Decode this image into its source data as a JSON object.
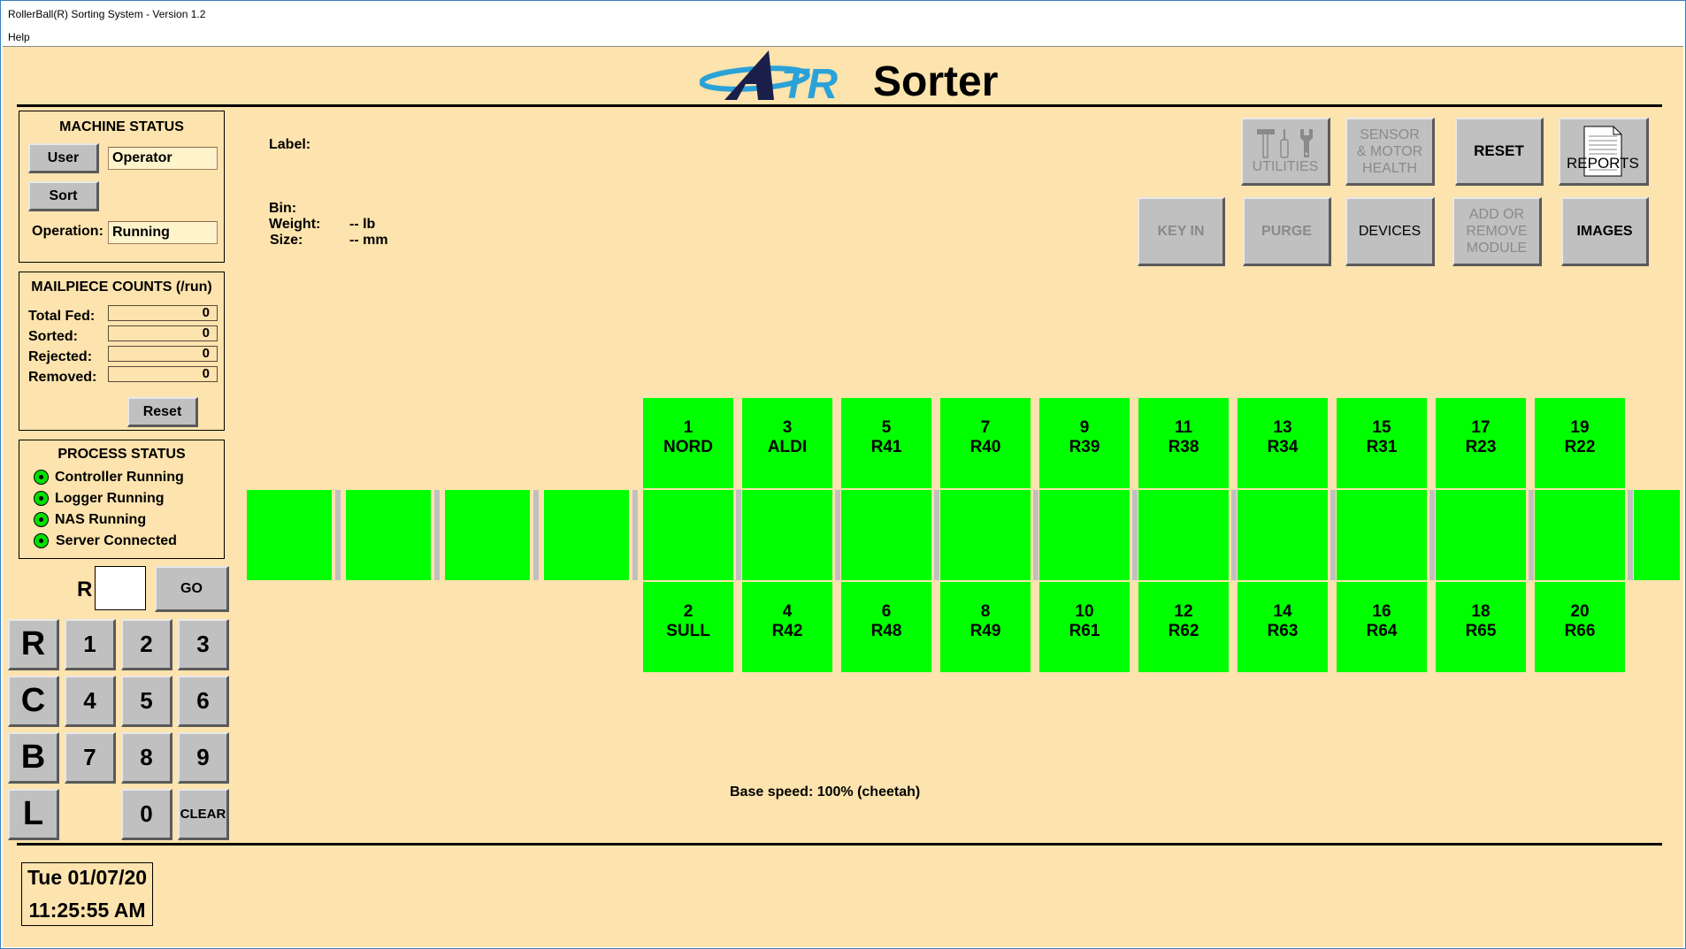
{
  "window": {
    "title": "RollerBall(R) Sorting System - Version 1.2",
    "menu": [
      "Help"
    ]
  },
  "header": {
    "logo_text": "TR",
    "title": "Sorter",
    "logo_colors": {
      "navy": "#1a1f4a",
      "blue": "#2aa2d8"
    }
  },
  "machine_status": {
    "title": "MACHINE STATUS",
    "user_button": "User",
    "user_value": "Operator",
    "sort_button": "Sort",
    "operation_label": "Operation:",
    "operation_value": "Running"
  },
  "mailpiece_counts": {
    "title": "MAILPIECE COUNTS (/run)",
    "rows": [
      {
        "label": "Total Fed:",
        "value": "0"
      },
      {
        "label": "Sorted:",
        "value": "0"
      },
      {
        "label": "Rejected:",
        "value": "0"
      },
      {
        "label": "Removed:",
        "value": "0"
      }
    ],
    "reset_button": "Reset"
  },
  "process_status": {
    "title": "PROCESS STATUS",
    "items": [
      {
        "label": "Controller Running",
        "status": "ok"
      },
      {
        "label": "Logger Running",
        "status": "ok"
      },
      {
        "label": "NAS Running",
        "status": "ok"
      },
      {
        "label": "Server Connected",
        "status": "ok"
      }
    ],
    "led_color": "#00e000"
  },
  "route_entry": {
    "prefix": "R",
    "value": "",
    "go_button": "GO"
  },
  "keypad": {
    "keys": [
      "R",
      "1",
      "2",
      "3",
      "C",
      "4",
      "5",
      "6",
      "B",
      "7",
      "8",
      "9",
      "L",
      "0",
      "CLEAR"
    ]
  },
  "datetime": {
    "date": "Tue 01/07/20",
    "time": "11:25:55 AM"
  },
  "piece_info": {
    "label_label": "Label:",
    "label_value": "",
    "bin_label": "Bin:",
    "bin_value": "",
    "weight_label": "Weight:",
    "weight_value": "-- lb",
    "size_label": "Size:",
    "size_value": "-- mm"
  },
  "toolbar": {
    "utilities": "UTILITIES",
    "sensor_motor_health": [
      "SENSOR",
      "& MOTOR",
      "HEALTH"
    ],
    "reset": "RESET",
    "reports": "REPORTS",
    "key_in": "KEY IN",
    "purge": "PURGE",
    "devices": "DEVICES",
    "add_remove_module": [
      "ADD OR",
      "REMOVE",
      "MODULE"
    ],
    "images": "IMAGES"
  },
  "bins": {
    "color": "#00ff00",
    "top": [
      {
        "number": "1",
        "name": "NORD"
      },
      {
        "number": "3",
        "name": "ALDI"
      },
      {
        "number": "5",
        "name": "R41"
      },
      {
        "number": "7",
        "name": "R40"
      },
      {
        "number": "9",
        "name": "R39"
      },
      {
        "number": "11",
        "name": "R38"
      },
      {
        "number": "13",
        "name": "R34"
      },
      {
        "number": "15",
        "name": "R31"
      },
      {
        "number": "17",
        "name": "R23"
      },
      {
        "number": "19",
        "name": "R22"
      }
    ],
    "bottom": [
      {
        "number": "2",
        "name": "SULL"
      },
      {
        "number": "4",
        "name": "R42"
      },
      {
        "number": "6",
        "name": "R48"
      },
      {
        "number": "8",
        "name": "R49"
      },
      {
        "number": "10",
        "name": "R61"
      },
      {
        "number": "12",
        "name": "R62"
      },
      {
        "number": "14",
        "name": "R63"
      },
      {
        "number": "16",
        "name": "R64"
      },
      {
        "number": "18",
        "name": "R65"
      },
      {
        "number": "20",
        "name": "R66"
      }
    ]
  },
  "base_speed": "Base speed: 100% (cheetah)"
}
